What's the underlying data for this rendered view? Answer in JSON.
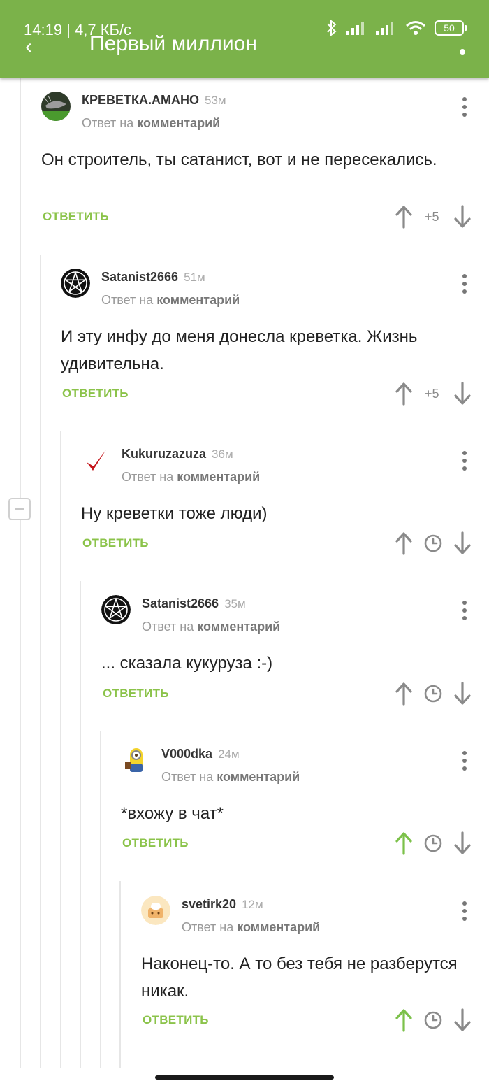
{
  "status_bar": {
    "time_speed": "14:19 | 4,7 КБ/с",
    "battery": "50"
  },
  "app_bar": {
    "title": "Первый миллион"
  },
  "common": {
    "reply_prefix": "Ответ на",
    "reply_target": "комментарий",
    "reply_label": "ОТВЕТИТЬ"
  },
  "comments": [
    {
      "author": "КРЕВЕТКА.АМАНО",
      "time": "53м",
      "text": "Он строитель, ты сатанист, вот и не пересекались.",
      "rating": "+5",
      "avatar": "shrimp-avatar"
    },
    {
      "author": "Satanist2666",
      "time": "51м",
      "text": "И эту инфу до меня донесла креветка. Жизнь удивительна.",
      "rating": "+5",
      "avatar": "pentagram-avatar"
    },
    {
      "author": "Kukuruzazuza",
      "time": "36м",
      "text": "Ну креветки тоже люди)",
      "rating": "",
      "avatar": "checkmark-avatar"
    },
    {
      "author": "Satanist2666",
      "time": "35м",
      "text": "... сказала кукуруза :-)",
      "rating": "",
      "avatar": "pentagram-avatar"
    },
    {
      "author": "V000dka",
      "time": "24м",
      "text": "*вхожу в чат*",
      "rating": "",
      "avatar": "minion-avatar",
      "upvoted": true
    },
    {
      "author": "svetirk20",
      "time": "12м",
      "text": "Наконец-то. А то без тебя не разберутся никак.",
      "rating": "",
      "avatar": "cat-avatar",
      "upvoted": true
    }
  ],
  "colors": {
    "brand_green": "#7bb24a",
    "reply_green": "#8bc34a",
    "upvote_active": "#7cc14a",
    "icon_gray": "#8a8a8a"
  }
}
